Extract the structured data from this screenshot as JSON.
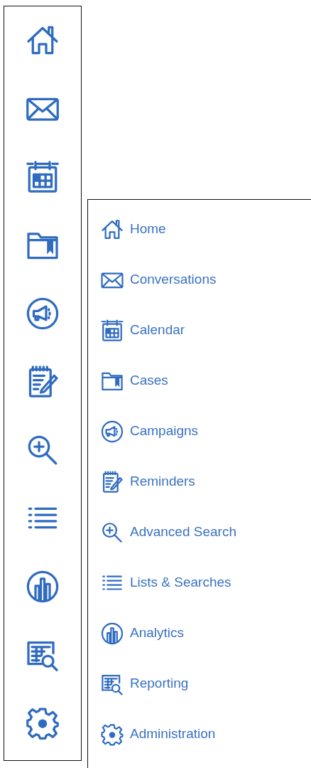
{
  "icon_rail": {
    "items": [
      {
        "kind": "home"
      },
      {
        "kind": "mail"
      },
      {
        "kind": "calendar"
      },
      {
        "kind": "folder"
      },
      {
        "kind": "megaphone"
      },
      {
        "kind": "notepad"
      },
      {
        "kind": "zoom"
      },
      {
        "kind": "list"
      },
      {
        "kind": "chart"
      },
      {
        "kind": "report"
      },
      {
        "kind": "gear"
      }
    ]
  },
  "menu_panel": {
    "items": [
      {
        "kind": "home",
        "label": "Home"
      },
      {
        "kind": "mail",
        "label": "Conversations"
      },
      {
        "kind": "calendar",
        "label": "Calendar"
      },
      {
        "kind": "folder",
        "label": "Cases"
      },
      {
        "kind": "megaphone",
        "label": "Campaigns"
      },
      {
        "kind": "notepad",
        "label": "Reminders"
      },
      {
        "kind": "zoom",
        "label": "Advanced Search"
      },
      {
        "kind": "list",
        "label": "Lists & Searches"
      },
      {
        "kind": "chart",
        "label": "Analytics"
      },
      {
        "kind": "report",
        "label": "Reporting"
      },
      {
        "kind": "gear",
        "label": "Administration"
      }
    ]
  }
}
